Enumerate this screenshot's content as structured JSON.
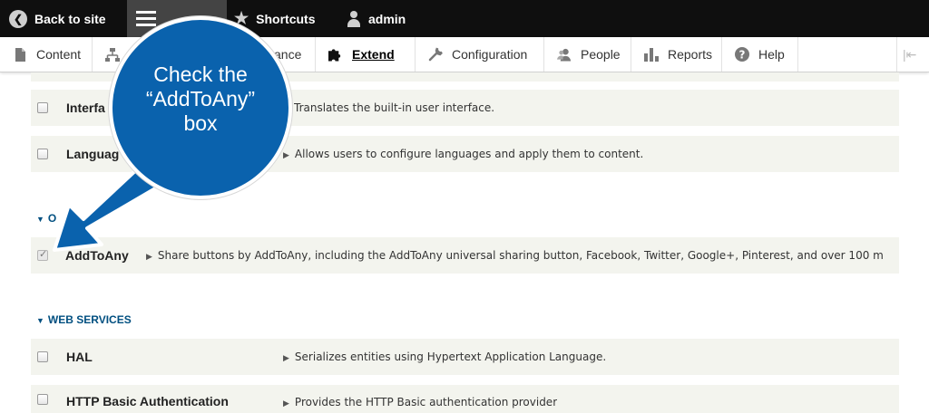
{
  "toolbar": {
    "back_label": "Back to site",
    "shortcuts_label": "Shortcuts",
    "user_label": "admin"
  },
  "tray": {
    "content": "Content",
    "structure": "Structure",
    "appearance_visible": "ance",
    "extend": "Extend",
    "configuration": "Configuration",
    "people": "People",
    "reports": "Reports",
    "help": "Help",
    "collapse_glyph": "|⇤"
  },
  "callout": {
    "text": "Check the “AddToAny” box",
    "color": "#0a62ad"
  },
  "modules": {
    "interface": {
      "name_visible": "Interfa",
      "description": "Translates the built-in user interface.",
      "checked": false
    },
    "language": {
      "name_visible": "Languag",
      "description": "Allows users to configure languages and apply them to content.",
      "checked": false
    },
    "other_group_visible": "O",
    "addtoany": {
      "name": "AddToAny",
      "description": "Share buttons by AddToAny, including the AddToAny universal sharing button, Facebook, Twitter, Google+, Pinterest, and over 100 m",
      "checked": true
    },
    "web_services_group": "WEB SERVICES",
    "hal": {
      "name": "HAL",
      "description": "Serializes entities using Hypertext Application Language.",
      "checked": false
    },
    "basic_auth": {
      "name": "HTTP Basic Authentication",
      "description": "Provides the HTTP Basic authentication provider",
      "checked": false
    }
  },
  "colors": {
    "toolbar_bg": "#0f0f0f",
    "row_bg": "#f3f4ee",
    "group_heading": "#004f80"
  }
}
